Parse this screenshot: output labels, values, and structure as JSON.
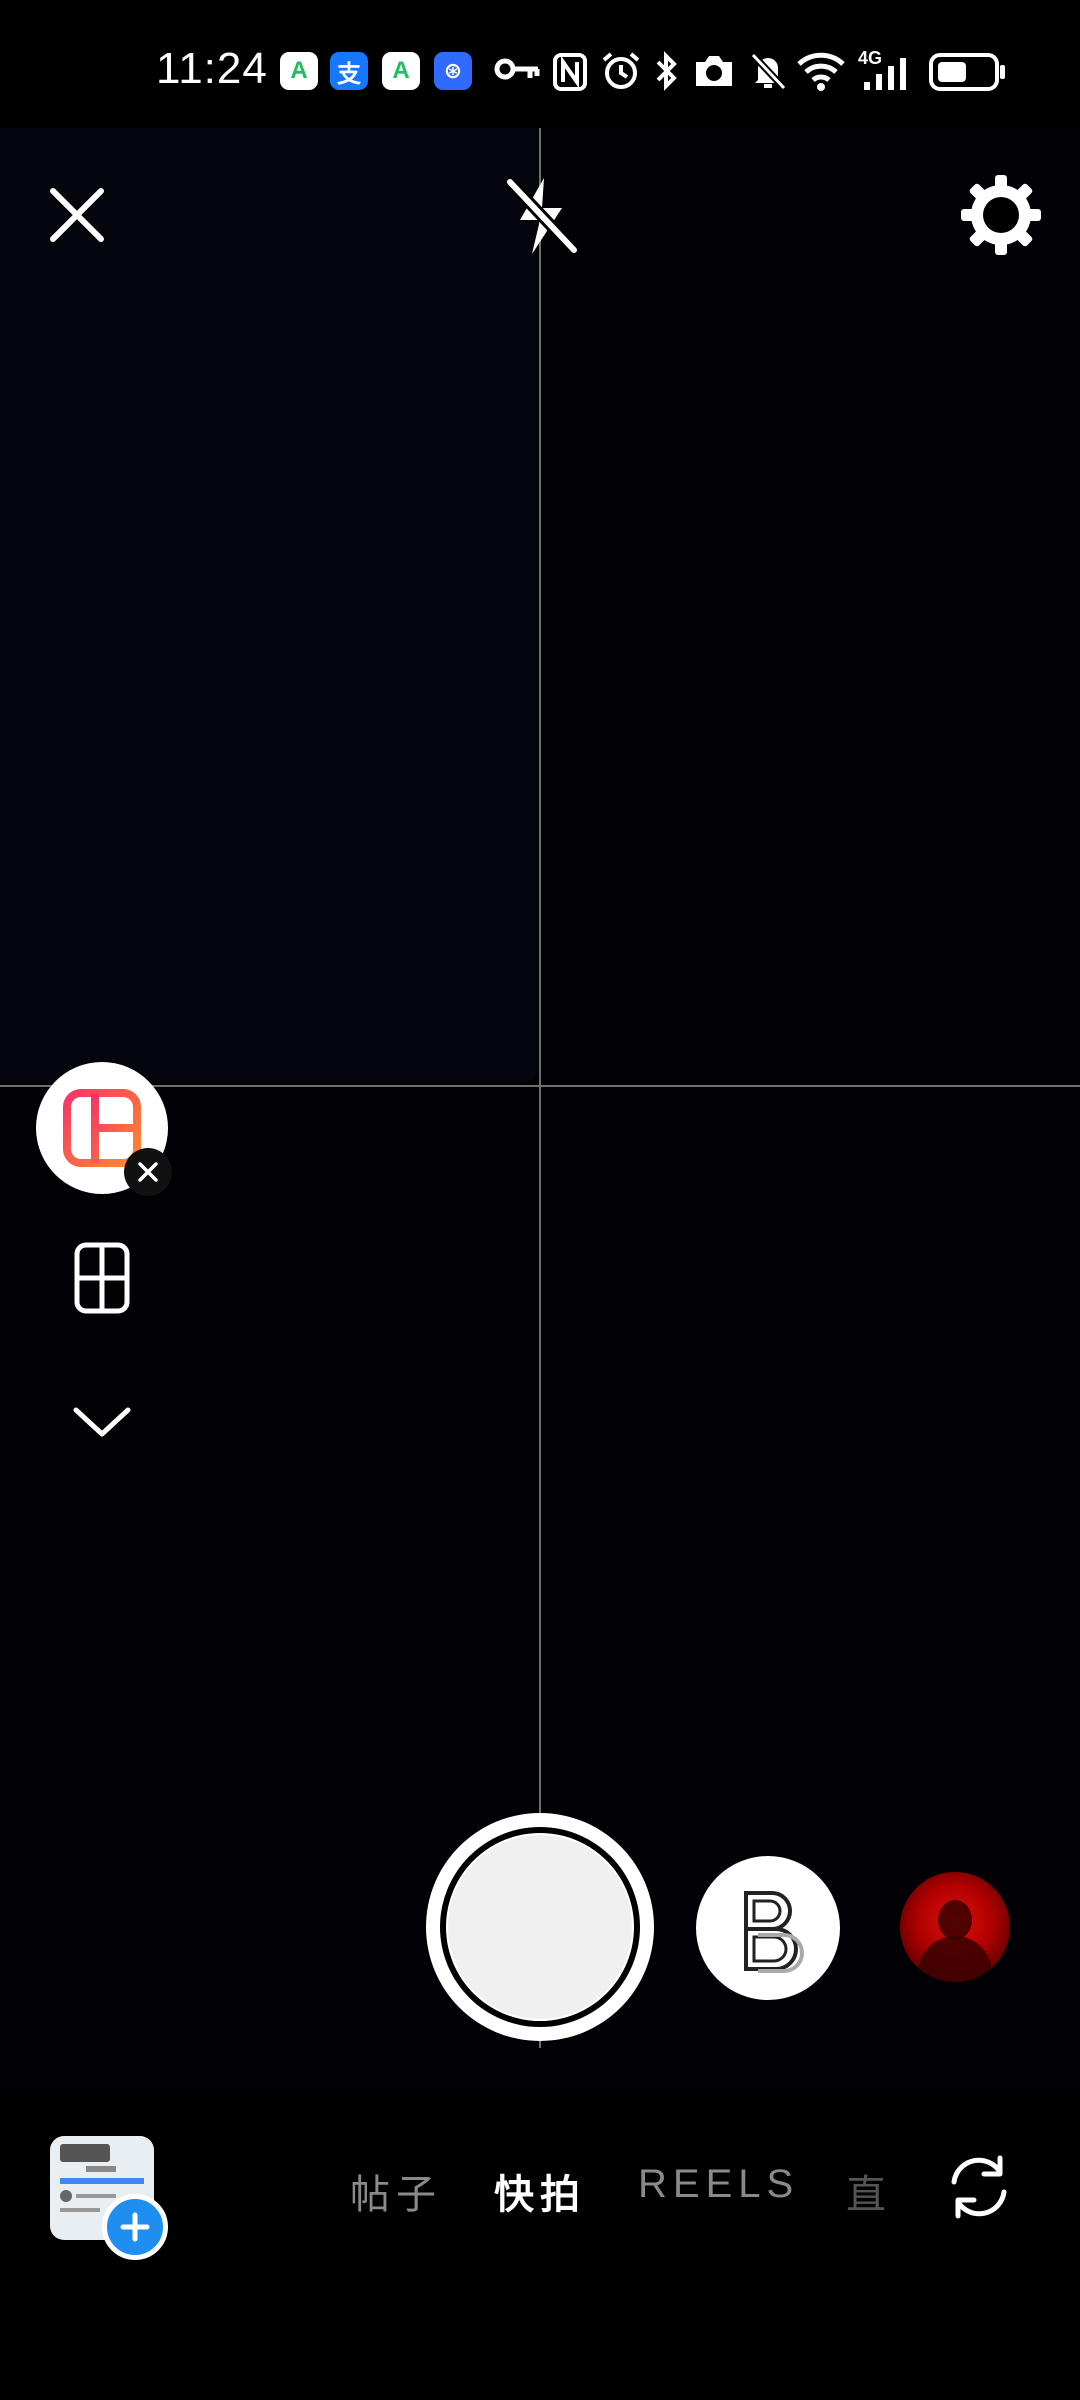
{
  "status_bar": {
    "time": "11:24",
    "app_icons": [
      {
        "name": "app-a-icon",
        "glyph": "A",
        "color": "#1fbf5f"
      },
      {
        "name": "alipay-icon",
        "glyph": "支",
        "color": "#1677ff"
      },
      {
        "name": "app-a-icon",
        "glyph": "A",
        "color": "#1fbf5f"
      },
      {
        "name": "app-shield-icon",
        "glyph": "⊛",
        "color": "#2f6bff"
      }
    ],
    "system_icons": [
      "key-icon",
      "nfc-icon",
      "alarm-icon",
      "bluetooth-icon",
      "camera-icon",
      "mute-icon",
      "wifi-icon",
      "signal-4g-icon",
      "battery-icon"
    ],
    "network": "4G"
  },
  "camera": {
    "top_controls": [
      "close-icon",
      "flash-off-icon",
      "settings-gear-icon"
    ],
    "left_tools": [
      "layout-icon",
      "grid-icon",
      "chevron-down-icon"
    ],
    "effects": [
      "boomerang-b-icon",
      "red-portrait-filter"
    ]
  },
  "modes": {
    "tabs": [
      {
        "label": "帖子"
      },
      {
        "label": "快拍"
      },
      {
        "label": "REELS"
      },
      {
        "label": "直"
      }
    ],
    "active_index": 1
  },
  "colors": {
    "accent_blue": "#1e8ff0",
    "grid_line": "#6f6f6f",
    "layout_gradient_start": "#f5356a",
    "layout_gradient_end": "#ff8a2a"
  }
}
